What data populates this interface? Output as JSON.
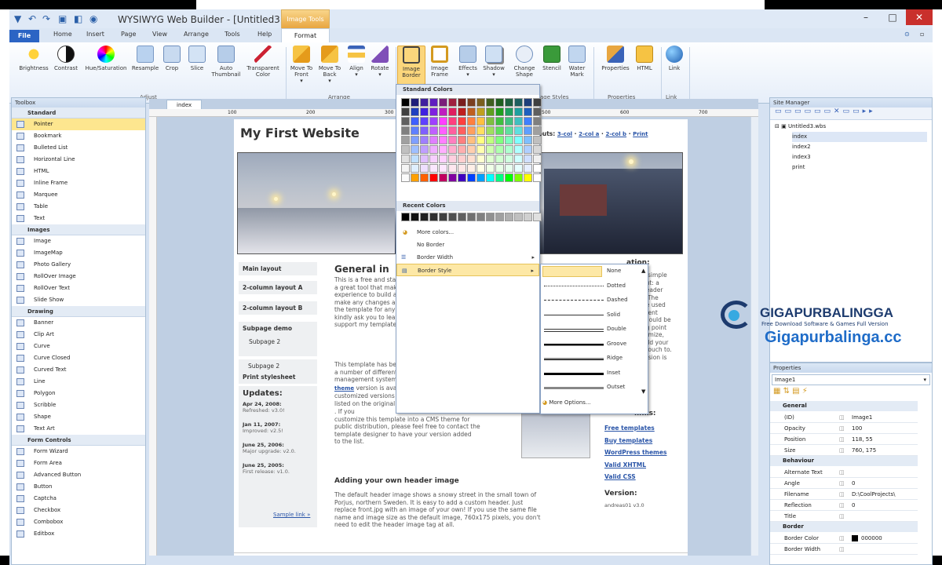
{
  "window": {
    "title": "WYSIWYG Web Builder - [Untitled3.wbs]",
    "image_tools_label": "Image Tools",
    "minimize": "–",
    "maximize": "□",
    "close": "✕"
  },
  "menu": {
    "file": "File",
    "tabs": [
      "Home",
      "Insert",
      "Page",
      "View",
      "Arrange",
      "Tools",
      "Help"
    ],
    "format": "Format"
  },
  "ribbon": {
    "adjust": [
      "Brightness",
      "Contrast",
      "Hue/Saturation",
      "Resample",
      "Crop",
      "Slice",
      "Auto Thumbnail",
      "Transparent Color"
    ],
    "arrange": [
      "Move To Front",
      "Move To Back",
      "Align",
      "Rotate"
    ],
    "image_styles": [
      "Image Border",
      "Image Frame",
      "Effects",
      "Shadow",
      "Change Shape",
      "Stencil",
      "Water Mark"
    ],
    "properties": [
      "Properties",
      "HTML"
    ],
    "link": [
      "Link"
    ],
    "groups": [
      "Adjust",
      "Arrange",
      "Image Styles",
      "Properties",
      "Link"
    ],
    "image_styles_group_partial": "age Styles"
  },
  "toolbox": {
    "title": "Toolbox",
    "sections": [
      {
        "name": "Standard",
        "items": [
          "Pointer",
          "Bookmark",
          "Bulleted List",
          "Horizontal Line",
          "HTML",
          "Inline Frame",
          "Marquee",
          "Table",
          "Text"
        ]
      },
      {
        "name": "Images",
        "items": [
          "Image",
          "ImageMap",
          "Photo Gallery",
          "RollOver Image",
          "RollOver Text",
          "Slide Show"
        ]
      },
      {
        "name": "Drawing",
        "items": [
          "Banner",
          "Clip Art",
          "Curve",
          "Curve Closed",
          "Curved Text",
          "Line",
          "Polygon",
          "Scribble",
          "Shape",
          "Text Art"
        ]
      },
      {
        "name": "Form Controls",
        "items": [
          "Form Wizard",
          "Form Area",
          "Advanced Button",
          "Button",
          "Captcha",
          "Checkbox",
          "Combobox",
          "Editbox"
        ]
      }
    ],
    "selected": "Pointer"
  },
  "editor": {
    "doc_tab": "index",
    "ruler_marks": [
      "100",
      "200",
      "300",
      "400",
      "500",
      "600",
      "700"
    ]
  },
  "site": {
    "title": "My First Website",
    "layouts_label": "ayouts:",
    "layouts": [
      "3-col",
      "2-col a",
      "2-col b",
      "Print"
    ],
    "nav": [
      "Main layout",
      "2-column layout A",
      "2-column layout B",
      "Subpage demo",
      "Subpage 2",
      "Subpage 2",
      "Print stylesheet"
    ],
    "heading": "General in",
    "para1": [
      "This is a free and standards-compliant XHTML/CSS web",
      "a great tool that makes it possible for people with limit",
      "experience to build a really good website. You are com",
      "make any changes and modifications that you may wan",
      "the template for any purpose without any obligations o",
      "kindly ask you to leave the original design credits in the",
      "support my template design work, but it is not any req"
    ],
    "para2": [
      "This template has been ported into themes for",
      "a number of different blogs and content",
      "management systems. An official",
      "version is available, and a number of",
      "customized versions for other systems are",
      "listed on the original",
      ". If you",
      "customize this template into a CMS theme for",
      "public distribution, please feel free to contact the",
      "template designer to have your version added",
      "to the list."
    ],
    "wordpress": "WordPress",
    "theme": "theme",
    "template_site": "template site",
    "heading2": "Adding your own header image",
    "para3": [
      "The default header image shows a snowy street in the small town of",
      "Porjus, northern Sweden. It is easy to add a custom header. Just",
      "replace front.jpg with an image of your own! If you use the same file",
      "name and image size as the default image, 760x175 pixels, you don't",
      "need to edit the header image tag at all."
    ],
    "updates_title": "Updates:",
    "updates": [
      {
        "date": "Apr 24, 2008:",
        "text": "Refreshed: v3.0!"
      },
      {
        "date": "Jan 11, 2007:",
        "text": "Improved: v2.5!"
      },
      {
        "date": "June 25, 2006:",
        "text": "Major upgrade: v2.0."
      },
      {
        "date": "June 25, 2005:",
        "text": "First release: v1.0."
      }
    ],
    "sample_link": "Sample link »",
    "right_heading": "ation:",
    "right_text": [
      "a simple",
      "out: a",
      "header",
      "l. The",
      "be used",
      "erent",
      "should be",
      "ng point",
      "tomize,",
      "add your",
      "l touch to.",
      "ersion is"
    ],
    "links_heading": "links:",
    "links": [
      "Free templates",
      "Buy templates",
      "WordPress themes",
      "Valid XHTML",
      "Valid CSS"
    ],
    "version_title": "Version:",
    "version_text": "andreas01 v3.0"
  },
  "border_menu": {
    "standard_colors": "Standard Colors",
    "recent_colors": "Recent Colors",
    "more_colors": "More colors...",
    "no_border": "No Border",
    "border_width": "Border Width",
    "border_style": "Border Style",
    "palette": [
      "#000000",
      "#1f1f7a",
      "#3f1f9f",
      "#5f1fbf",
      "#7a1f7a",
      "#9f1f3f",
      "#7a1f1f",
      "#7a3f1f",
      "#7a5f1f",
      "#3f5f1f",
      "#1f5f1f",
      "#1f5f3f",
      "#1f5f5f",
      "#1f3f7a",
      "#3f3f3f",
      "#404040",
      "#1f3fbf",
      "#3f1fdf",
      "#7f1fdf",
      "#bf1fbf",
      "#df1f5f",
      "#bf1f1f",
      "#bf5f1f",
      "#bf9f1f",
      "#5f9f1f",
      "#1f9f1f",
      "#1f9f5f",
      "#1f9f9f",
      "#1f5fbf",
      "#5f5f5f",
      "#606060",
      "#3f5fff",
      "#5f3fff",
      "#9f3fff",
      "#ff3fff",
      "#ff3f7f",
      "#ff3f3f",
      "#ff7f3f",
      "#ffbf3f",
      "#7fbf3f",
      "#3fbf3f",
      "#3fbf7f",
      "#3fbfbf",
      "#3f7fff",
      "#7f7f7f",
      "#808080",
      "#5f7fff",
      "#7f5fff",
      "#bf5fff",
      "#ff5fff",
      "#ff5f9f",
      "#ff5f5f",
      "#ff9f5f",
      "#ffdf5f",
      "#9fdf5f",
      "#5fdf5f",
      "#5fdf9f",
      "#5fdfdf",
      "#5f9fff",
      "#9f9f9f",
      "#a0a0a0",
      "#7f9fff",
      "#9f7fff",
      "#df7fff",
      "#ff7fff",
      "#ff7fbf",
      "#ff7f7f",
      "#ffbf7f",
      "#ffff7f",
      "#bfff7f",
      "#7fff7f",
      "#7fffbf",
      "#7fffff",
      "#7fbfff",
      "#bfbfbf",
      "#c0c0c0",
      "#9fbfff",
      "#bf9fff",
      "#efafff",
      "#ffafff",
      "#ffafcf",
      "#ffafaf",
      "#ffcfaf",
      "#ffffaf",
      "#cfffaf",
      "#afffaf",
      "#afffcf",
      "#afffff",
      "#afcfff",
      "#d8d8d8",
      "#e0e0e0",
      "#bfdfff",
      "#dfbfff",
      "#f7cfff",
      "#ffcfff",
      "#ffcfdf",
      "#ffcfcf",
      "#ffdfcf",
      "#ffffcf",
      "#dfffcf",
      "#cfffcf",
      "#cfffdf",
      "#cfffff",
      "#cfdfff",
      "#f0f0f0",
      "#f4f4f4",
      "#dfefff",
      "#efdfff",
      "#fbe7ff",
      "#ffe7ff",
      "#ffe7ef",
      "#ffe7e7",
      "#ffefe7",
      "#ffffe7",
      "#efffe7",
      "#e7ffe7",
      "#e7ffef",
      "#e7ffff",
      "#e7efff",
      "#ffffff",
      "#fafafa",
      "#ffa000",
      "#ff6000",
      "#ff0000",
      "#c00060",
      "#8000a0",
      "#4000c0",
      "#0040ff",
      "#00a0ff",
      "#00ffff",
      "#00ff80",
      "#00ff00",
      "#80ff00",
      "#ffff00",
      "#ffffff"
    ],
    "recent": [
      "#000000",
      "#101010",
      "#202020",
      "#303030",
      "#404040",
      "#505050",
      "#606060",
      "#707070",
      "#808080",
      "#909090",
      "#a0a0a0",
      "#b0b0b0",
      "#c0c0c0",
      "#d0d0d0",
      "#e0e0e0"
    ]
  },
  "border_styles": {
    "items": [
      "None",
      "Dotted",
      "Dashed",
      "Solid",
      "Double",
      "Groove",
      "Ridge",
      "Inset",
      "Outset"
    ],
    "more": "More Options..."
  },
  "site_manager": {
    "title": "Site Manager",
    "root": "Untitled3.wbs",
    "pages": [
      "index",
      "index2",
      "index3",
      "print"
    ]
  },
  "properties": {
    "title": "Properties",
    "object": "Image1",
    "general": "General",
    "rows": [
      {
        "name": "(ID)",
        "value": "Image1"
      },
      {
        "name": "Opacity",
        "value": "100"
      },
      {
        "name": "Position",
        "value": "118, 55"
      },
      {
        "name": "Size",
        "value": "760, 175"
      }
    ],
    "behaviour": "Behaviour",
    "rows2": [
      {
        "name": "Alternate Text",
        "value": ""
      },
      {
        "name": "Angle",
        "value": "0"
      },
      {
        "name": "Filename",
        "value": "D:\\CoolProjects\\"
      },
      {
        "name": "Reflection",
        "value": "0"
      },
      {
        "name": "Title",
        "value": ""
      }
    ],
    "border": "Border",
    "rows3": [
      {
        "name": "Border Color",
        "value": "000000"
      },
      {
        "name": "Border Width",
        "value": ""
      }
    ]
  },
  "watermark": {
    "brand": "GIGAPURBALINGGA",
    "tagline": "Free Download Software & Games Full Version",
    "url": "Gigapurbalinga.cc"
  }
}
